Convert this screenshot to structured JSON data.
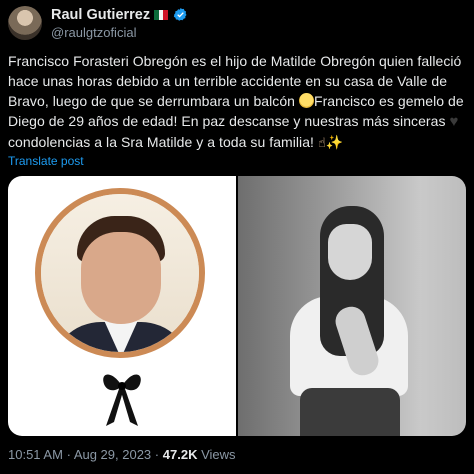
{
  "author": {
    "display_name": "Raul Gutierrez",
    "handle": "@raulgtzoficial",
    "flag_icon": "mexico-flag-icon",
    "verified_icon": "verified-badge-icon",
    "verified_color": "#1d9bf0"
  },
  "tweet": {
    "lines": [
      "Francisco Forasteri Obregón es el hijo de Matilde Obregón quien falleció",
      "hace unas horas debido a un terrible accidente en su casa de Valle de",
      "Bravo, luego de que se derrumbara un balcón",
      "Francisco es gemelo de",
      "Diego de 29 años de edad! En paz descanse y nuestras más sinceras",
      "condolencias a la Sra Matilde y a toda su familia!"
    ],
    "emojis": {
      "sad": "sad-face-emoji",
      "heart": "black-heart-emoji",
      "pray": "praying-hands-emoji",
      "sparkles": "sparkles-emoji"
    }
  },
  "translate_label": "Translate post",
  "media": {
    "left": "portrait-with-mourning-ribbon",
    "right": "black-and-white-portrait"
  },
  "meta": {
    "time": "10:51 AM",
    "separator": "·",
    "date": "Aug 29, 2023",
    "views_count": "47.2K",
    "views_label": "Views"
  },
  "colors": {
    "background": "#000000",
    "text": "#e7e9ea",
    "secondary": "#8b98a5",
    "link": "#1d9bf0",
    "portrait_ring": "#cc8a55"
  }
}
